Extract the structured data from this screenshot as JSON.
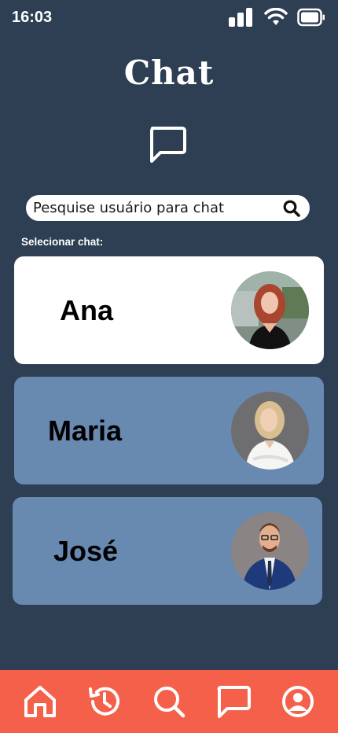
{
  "status_bar": {
    "time": "16:03",
    "icons": [
      "signal-icon",
      "wifi-icon",
      "battery-icon"
    ]
  },
  "header": {
    "title": "Chat",
    "icon": "chat-bubble-icon"
  },
  "search": {
    "placeholder": "Pesquise usuário para chat",
    "icon": "search-icon"
  },
  "chat_list": {
    "label": "Selecionar  chat:",
    "items": [
      {
        "name": "Ana",
        "selected": true,
        "avatar": "avatar-ana"
      },
      {
        "name": "Maria",
        "selected": false,
        "avatar": "avatar-maria"
      },
      {
        "name": "José",
        "selected": false,
        "avatar": "avatar-jose"
      }
    ]
  },
  "bottom_nav": {
    "items": [
      "home-icon",
      "history-icon",
      "search-icon",
      "chat-icon",
      "profile-icon"
    ]
  },
  "colors": {
    "background": "#2e3e53",
    "card_selected": "#ffffff",
    "card_default": "#6889b0",
    "nav_bar": "#f4604a"
  }
}
